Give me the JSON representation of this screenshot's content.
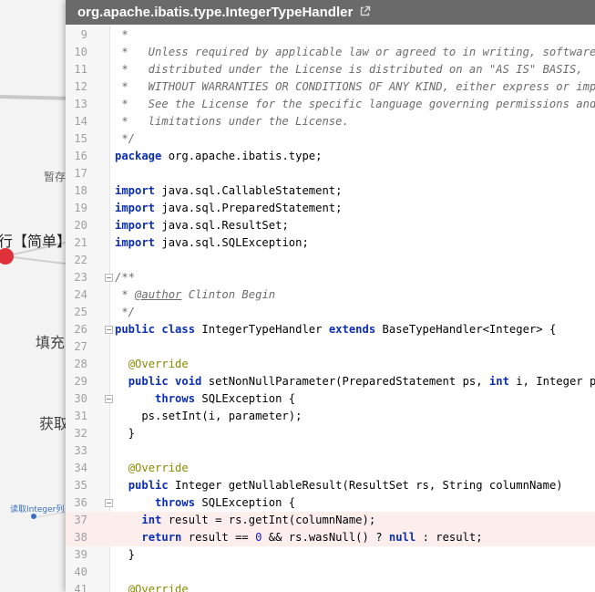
{
  "window": {
    "title": "org.apache.ibatis.type.IntegerTypeHandler",
    "external_link_icon": "external-link-icon"
  },
  "background": {
    "nodes": {
      "zancun": "暂存",
      "main": "行【简单】",
      "tianchong": "填充",
      "huoqu": "获取",
      "read_int_col": "读取Integer列"
    },
    "accent_color": "#e0313b",
    "small_dot_color": "#3a6ec0"
  },
  "code": {
    "highlight_color": "#fdeeee",
    "lines": [
      {
        "n": "9",
        "segs": [
          [
            "cm",
            " *"
          ]
        ]
      },
      {
        "n": "10",
        "segs": [
          [
            "cm",
            " *   Unless required by applicable law or agreed to in writing, software"
          ]
        ]
      },
      {
        "n": "11",
        "segs": [
          [
            "cm",
            " *   distributed under the License is distributed on an \"AS IS\" BASIS,"
          ]
        ]
      },
      {
        "n": "12",
        "segs": [
          [
            "cm",
            " *   WITHOUT WARRANTIES OR CONDITIONS OF ANY KIND, either express or implied."
          ]
        ]
      },
      {
        "n": "13",
        "segs": [
          [
            "cm",
            " *   See the License for the specific language governing permissions and"
          ]
        ]
      },
      {
        "n": "14",
        "segs": [
          [
            "cm",
            " *   limitations under the License."
          ]
        ]
      },
      {
        "n": "15",
        "segs": [
          [
            "cm",
            " */"
          ]
        ]
      },
      {
        "n": "16",
        "segs": [
          [
            "kw",
            "package"
          ],
          [
            "pl",
            " org.apache.ibatis.type;"
          ]
        ]
      },
      {
        "n": "17",
        "segs": []
      },
      {
        "n": "18",
        "segs": [
          [
            "kw",
            "import"
          ],
          [
            "pl",
            " java.sql.CallableStatement;"
          ]
        ]
      },
      {
        "n": "19",
        "segs": [
          [
            "kw",
            "import"
          ],
          [
            "pl",
            " java.sql.PreparedStatement;"
          ]
        ]
      },
      {
        "n": "20",
        "segs": [
          [
            "kw",
            "import"
          ],
          [
            "pl",
            " java.sql.ResultSet;"
          ]
        ]
      },
      {
        "n": "21",
        "segs": [
          [
            "kw",
            "import"
          ],
          [
            "pl",
            " java.sql.SQLException;"
          ]
        ]
      },
      {
        "n": "22",
        "segs": []
      },
      {
        "n": "23",
        "fold": true,
        "segs": [
          [
            "cm",
            "/**"
          ]
        ]
      },
      {
        "n": "24",
        "segs": [
          [
            "cm",
            " * "
          ],
          [
            "cm tg",
            "@author"
          ],
          [
            "cm",
            " Clinton Begin"
          ]
        ]
      },
      {
        "n": "25",
        "segs": [
          [
            "cm",
            " */"
          ]
        ]
      },
      {
        "n": "26",
        "fold": true,
        "segs": [
          [
            "kw",
            "public class"
          ],
          [
            "pl",
            " IntegerTypeHandler "
          ],
          [
            "kw",
            "extends"
          ],
          [
            "pl",
            " BaseTypeHandler<Integer> {"
          ]
        ]
      },
      {
        "n": "27",
        "segs": []
      },
      {
        "n": "28",
        "segs": [
          [
            "pl",
            "  "
          ],
          [
            "an",
            "@Override"
          ]
        ]
      },
      {
        "n": "29",
        "segs": [
          [
            "pl",
            "  "
          ],
          [
            "kw",
            "public void"
          ],
          [
            "pl",
            " setNonNullParameter(PreparedStatement ps, "
          ],
          [
            "kw",
            "int"
          ],
          [
            "pl",
            " i, Integer parameter, JdbcType jdbcType)"
          ]
        ]
      },
      {
        "n": "30",
        "fold": true,
        "segs": [
          [
            "pl",
            "      "
          ],
          [
            "kw",
            "throws"
          ],
          [
            "pl",
            " SQLException {"
          ]
        ]
      },
      {
        "n": "31",
        "segs": [
          [
            "pl",
            "    ps.setInt(i, parameter);"
          ]
        ]
      },
      {
        "n": "32",
        "segs": [
          [
            "pl",
            "  }"
          ]
        ]
      },
      {
        "n": "33",
        "segs": []
      },
      {
        "n": "34",
        "segs": [
          [
            "pl",
            "  "
          ],
          [
            "an",
            "@Override"
          ]
        ]
      },
      {
        "n": "35",
        "segs": [
          [
            "pl",
            "  "
          ],
          [
            "kw",
            "public"
          ],
          [
            "pl",
            " Integer getNullableResult(ResultSet rs, String columnName)"
          ]
        ]
      },
      {
        "n": "36",
        "fold": true,
        "segs": [
          [
            "pl",
            "      "
          ],
          [
            "kw",
            "throws"
          ],
          [
            "pl",
            " SQLException {"
          ]
        ]
      },
      {
        "n": "37",
        "hl": true,
        "segs": [
          [
            "pl",
            "    "
          ],
          [
            "kw",
            "int"
          ],
          [
            "pl",
            " result = rs.getInt(columnName);"
          ]
        ]
      },
      {
        "n": "38",
        "hl": true,
        "segs": [
          [
            "pl",
            "    "
          ],
          [
            "kw",
            "return"
          ],
          [
            "pl",
            " result == "
          ],
          [
            "nm",
            "0"
          ],
          [
            "pl",
            " && rs.wasNull() ? "
          ],
          [
            "kw",
            "null"
          ],
          [
            "pl",
            " : result;"
          ]
        ]
      },
      {
        "n": "39",
        "segs": [
          [
            "pl",
            "  }"
          ]
        ]
      },
      {
        "n": "40",
        "segs": []
      },
      {
        "n": "41",
        "segs": [
          [
            "pl",
            "  "
          ],
          [
            "an",
            "@Override"
          ]
        ]
      }
    ]
  }
}
